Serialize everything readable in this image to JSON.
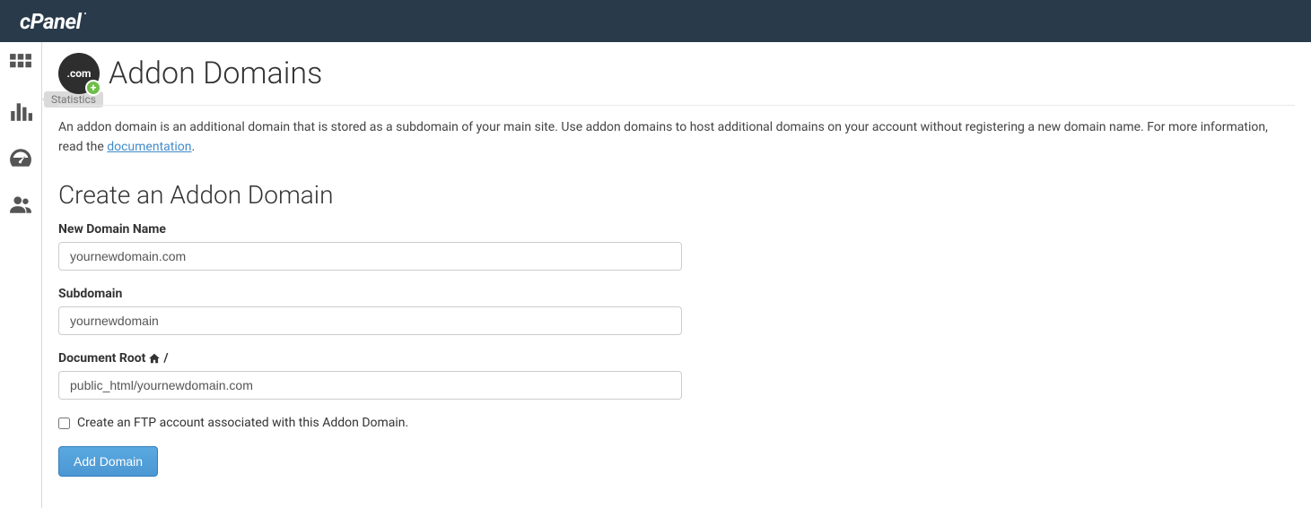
{
  "header": {
    "logo_text": "cPanel"
  },
  "sidebar": {
    "tooltip": "Statistics"
  },
  "page": {
    "title": "Addon Domains",
    "icon_text": ".com",
    "intro_pre": "An addon domain is an additional domain that is stored as a subdomain of your main site. Use addon domains to host additional domains on your account without registering a new domain name. For more information, read the ",
    "intro_link": "documentation",
    "intro_post": "."
  },
  "form": {
    "heading": "Create an Addon Domain",
    "new_domain_label": "New Domain Name",
    "new_domain_value": "yournewdomain.com",
    "subdomain_label": "Subdomain",
    "subdomain_value": "yournewdomain",
    "docroot_label_pre": "Document Root ",
    "docroot_label_post": "/",
    "docroot_value": "public_html/yournewdomain.com",
    "ftp_checkbox_label": "Create an FTP account associated with this Addon Domain.",
    "submit_label": "Add Domain"
  }
}
